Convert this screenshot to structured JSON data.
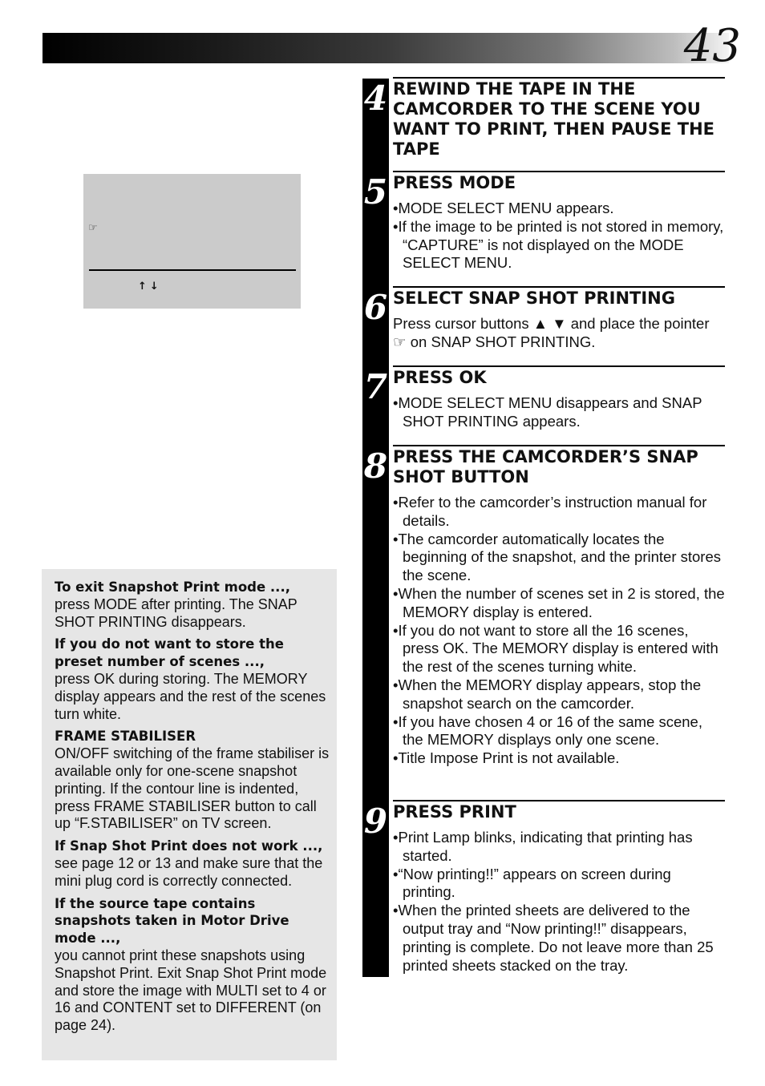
{
  "header": {
    "page_number": "43"
  },
  "screen_illustration": {
    "pointer_icon": "☞",
    "arrows": "↑↓"
  },
  "steps": [
    {
      "number": "4",
      "title": "REWIND THE TAPE IN THE CAMCORDER TO THE SCENE YOU WANT TO PRINT, THEN PAUSE THE TAPE",
      "body": []
    },
    {
      "number": "5",
      "title": "PRESS MODE",
      "bullets": [
        "•MODE SELECT MENU appears.",
        "•If the image to be printed is not stored in memory, “CAPTURE” is not displayed on the MODE SELECT MENU."
      ]
    },
    {
      "number": "6",
      "title": "SELECT SNAP SHOT PRINTING",
      "text": "Press cursor buttons ▲  ▼ and place the pointer ☞ on SNAP SHOT PRINTING."
    },
    {
      "number": "7",
      "title": "PRESS OK",
      "bullets": [
        "•MODE SELECT MENU disappears and SNAP SHOT PRINTING appears."
      ]
    },
    {
      "number": "8",
      "title": "PRESS THE CAMCORDER’S SNAP SHOT BUTTON",
      "bullets": [
        "•Refer to the camcorder’s instruction manual for details.",
        "•The camcorder automatically locates the beginning of the snapshot, and the printer stores the scene.",
        "•When the number of scenes set in 2 is stored, the MEMORY display is entered.",
        "•If you do not want to store all the 16 scenes, press OK. The MEMORY display is entered with the rest of the scenes turning white.",
        "•When the MEMORY display appears, stop the snapshot search on the camcorder.",
        "•If you have chosen 4 or 16 of the same scene, the MEMORY displays only one scene.",
        "•Title Impose Print is not available."
      ]
    },
    {
      "number": "9",
      "title": "PRESS PRINT",
      "bullets": [
        "•Print Lamp blinks, indicating that printing has started.",
        "•“Now printing!!” appears on screen during printing.",
        "•When the printed sheets are delivered to the output tray and “Now printing!!” disappears, printing is complete.  Do not leave more than 25 printed sheets stacked on the tray."
      ]
    }
  ],
  "notes": [
    {
      "title": "To exit Snapshot Print mode ...,",
      "body": "press MODE after printing. The SNAP SHOT PRINTING disappears."
    },
    {
      "title": "If you do not want to store the preset number of scenes ...,",
      "body": "press OK during storing. The MEMORY display appears and the rest of the scenes turn white."
    },
    {
      "title": "FRAME STABILISER",
      "body": "ON/OFF switching of the frame stabiliser is available only for one-scene snapshot printing. If the contour line is indented, press FRAME STABILISER button to call up “F.STABILISER” on TV screen."
    },
    {
      "title": "If Snap Shot Print does not work ...,",
      "body": "see page 12 or 13 and make sure that the mini plug cord is correctly connected."
    },
    {
      "title": "If the source tape contains snapshots taken in Motor Drive mode ...,",
      "body": "you cannot print these snapshots using Snapshot Print. Exit Snap Shot Print mode and store the image with MULTI set to 4 or 16 and CONTENT set to DIFFERENT (on page 24)."
    }
  ]
}
